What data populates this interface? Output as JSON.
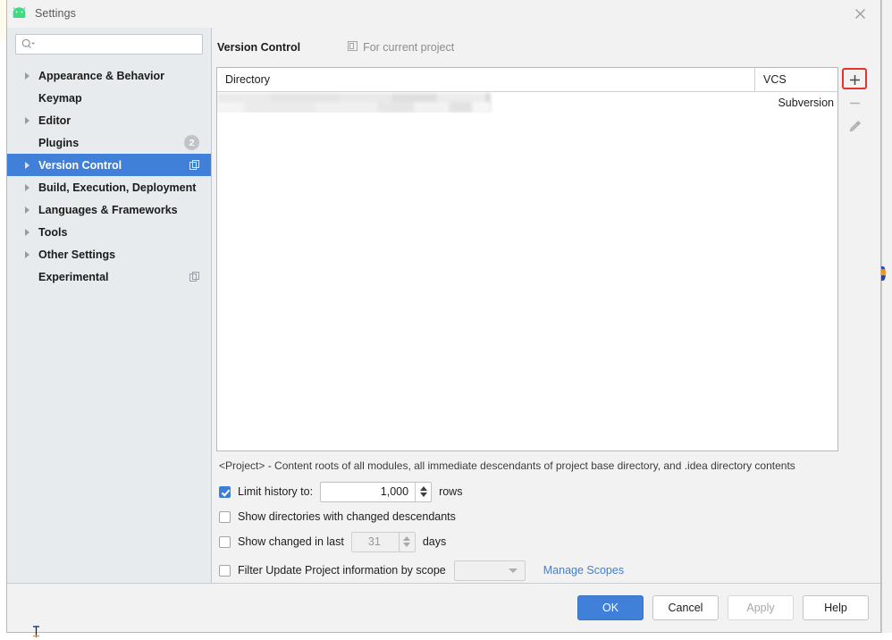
{
  "window": {
    "title": "Settings",
    "app_icon": "android-icon",
    "close_icon": "close-icon"
  },
  "sidebar": {
    "search": {
      "value": "",
      "placeholder": "",
      "icon": "search-icon"
    },
    "items": [
      {
        "label": "Appearance & Behavior",
        "arrow": true,
        "selected": false,
        "badge": null,
        "scope_icon": false
      },
      {
        "label": "Keymap",
        "arrow": false,
        "selected": false,
        "badge": null,
        "scope_icon": false
      },
      {
        "label": "Editor",
        "arrow": true,
        "selected": false,
        "badge": null,
        "scope_icon": false
      },
      {
        "label": "Plugins",
        "arrow": false,
        "selected": false,
        "badge": "2",
        "scope_icon": false
      },
      {
        "label": "Version Control",
        "arrow": true,
        "selected": true,
        "badge": null,
        "scope_icon": true
      },
      {
        "label": "Build, Execution, Deployment",
        "arrow": true,
        "selected": false,
        "badge": null,
        "scope_icon": false
      },
      {
        "label": "Languages & Frameworks",
        "arrow": true,
        "selected": false,
        "badge": null,
        "scope_icon": false
      },
      {
        "label": "Tools",
        "arrow": true,
        "selected": false,
        "badge": null,
        "scope_icon": false
      },
      {
        "label": "Other Settings",
        "arrow": true,
        "selected": false,
        "badge": null,
        "scope_icon": false
      },
      {
        "label": "Experimental",
        "arrow": false,
        "selected": false,
        "badge": null,
        "scope_icon": true
      }
    ]
  },
  "main": {
    "title": "Version Control",
    "scope_hint": "For current project",
    "scope_hint_icon": "project-scope-icon",
    "table": {
      "columns": [
        "Directory",
        "VCS"
      ],
      "rows": [
        {
          "directory": "",
          "directory_redacted": true,
          "vcs": "Subversion"
        }
      ]
    },
    "table_tools": [
      {
        "name": "add-directory-button",
        "icon": "plus-icon",
        "enabled": true,
        "highlighted": true
      },
      {
        "name": "remove-directory-button",
        "icon": "minus-icon",
        "enabled": false,
        "highlighted": false
      },
      {
        "name": "edit-directory-button",
        "icon": "pencil-icon",
        "enabled": false,
        "highlighted": false
      }
    ],
    "hint": "<Project> - Content roots of all modules, all immediate descendants of project base directory, and .idea directory contents",
    "options": {
      "limit_history": {
        "label": "Limit history to:",
        "checked": true,
        "value": "1,000",
        "unit": "rows"
      },
      "show_changed_descendants": {
        "label": "Show directories with changed descendants",
        "checked": false
      },
      "show_changed_in_last": {
        "label": "Show changed in last",
        "checked": false,
        "value": "31",
        "unit": "days"
      },
      "filter_by_scope": {
        "label": "Filter Update Project information by scope",
        "checked": false,
        "selected_scope": "",
        "manage_link": "Manage Scopes"
      }
    }
  },
  "footer": {
    "ok": "OK",
    "cancel": "Cancel",
    "apply": "Apply",
    "help": "Help"
  },
  "colors": {
    "accent": "#4080d8",
    "annotation": "#e8322c",
    "sidebar_bg": "#e8ebed",
    "dialog_bg": "#f2f2f2",
    "link": "#3d7fd8"
  }
}
